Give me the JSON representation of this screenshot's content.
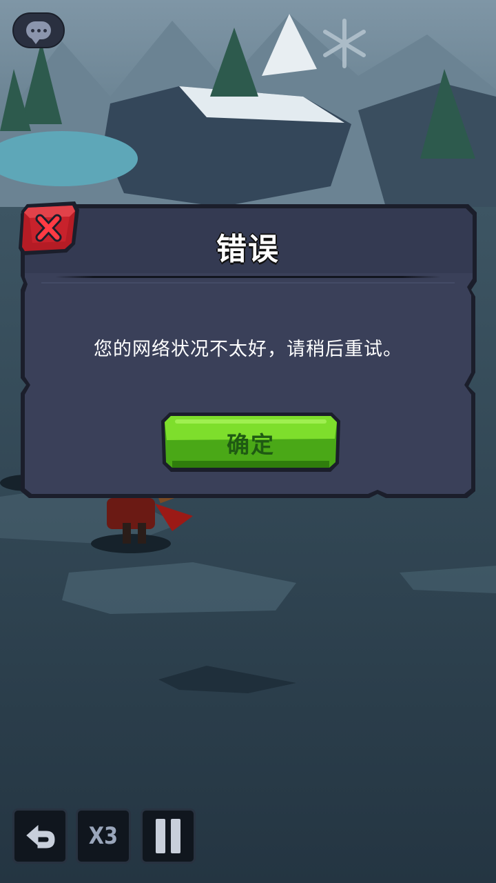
{
  "hud": {
    "chat_icon": "chat-bubble-icon",
    "back_icon": "return-arrow-icon",
    "speed_label": "X3",
    "pause_icon": "pause-icon"
  },
  "dialog": {
    "title": "错误",
    "message": "您的网络状况不太好，请稍后重试。",
    "confirm_label": "确定",
    "close_icon": "close-x-icon"
  },
  "colors": {
    "dialog_bg": "#3a4059",
    "dialog_border": "#1b1e2b",
    "confirm_green": "#5cc21f",
    "close_red": "#c0202a"
  }
}
